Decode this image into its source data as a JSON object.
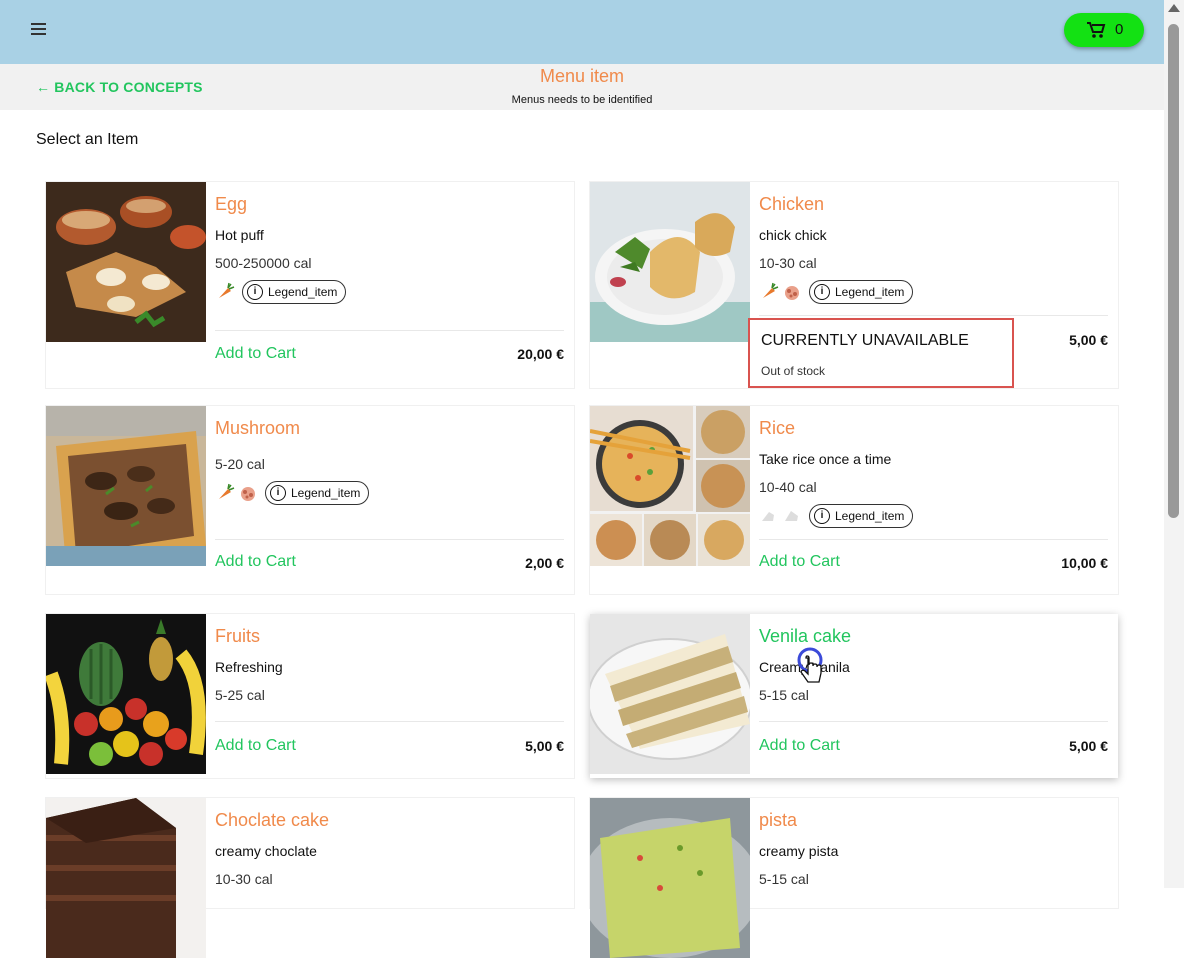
{
  "header": {
    "cart_count": "0",
    "colors": {
      "topbar": "#a9d1e5",
      "cart": "#13e113",
      "accent_orange": "#f08a4b",
      "accent_green": "#22c55e"
    }
  },
  "subheader": {
    "back_label": "← BACK TO CONCEPTS",
    "title": "Menu item",
    "subtitle": "Menus needs to be identified"
  },
  "section_title": "Select an Item",
  "legend_label": "Legend_item",
  "add_label": "Add to Cart",
  "items": [
    {
      "name": "Egg",
      "desc": "Hot puff",
      "cal": "500-250000 cal",
      "price": "20,00 €"
    },
    {
      "name": "Chicken",
      "desc": "chick chick",
      "cal": "10-30 cal",
      "price": "5,00 €",
      "status": "CURRENTLY UNAVAILABLE",
      "status_detail": "Out of stock"
    },
    {
      "name": "Mushroom",
      "desc": "",
      "cal": "5-20 cal",
      "price": "2,00 €"
    },
    {
      "name": "Rice",
      "desc": "Take rice once a time",
      "cal": "10-40 cal",
      "price": "10,00 €"
    },
    {
      "name": "Fruits",
      "desc": "Refreshing",
      "cal": "5-25 cal",
      "price": "5,00 €"
    },
    {
      "name": "Venila cake",
      "desc": "Creamy Vanila",
      "cal": "5-15 cal",
      "price": "5,00 €"
    },
    {
      "name": "Choclate cake",
      "desc": "creamy choclate",
      "cal": "10-30 cal"
    },
    {
      "name": "pista",
      "desc": "creamy pista",
      "cal": "5-15 cal"
    }
  ]
}
